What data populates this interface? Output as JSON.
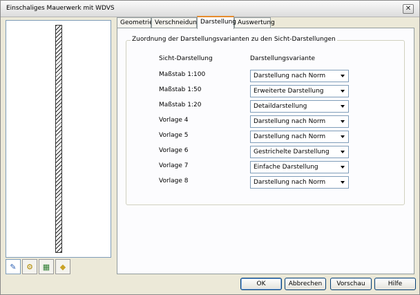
{
  "window": {
    "title": "Einschaliges Mauerwerk mit WDVS",
    "close_glyph": "✕"
  },
  "side_tabs": [
    {
      "icon": "wall-icon",
      "glyph": "✎"
    },
    {
      "icon": "materials-icon",
      "glyph": "⚙"
    },
    {
      "icon": "sheet-icon",
      "glyph": "▦"
    },
    {
      "icon": "tag-icon",
      "glyph": "◆"
    }
  ],
  "tabs": [
    {
      "label": "Geometrie"
    },
    {
      "label": "Verschneidung"
    },
    {
      "label": "Darstellung",
      "active": true
    },
    {
      "label": "Auswertung"
    }
  ],
  "group": {
    "legend": "Zuordnung der Darstellungsvarianten zu den Sicht-Darstellungen",
    "col_view": "Sicht-Darstellung",
    "col_variant": "Darstellungsvariante",
    "rows": [
      {
        "label": "Maßstab 1:100",
        "value": "Darstellung nach Norm"
      },
      {
        "label": "Maßstab 1:50",
        "value": "Erweiterte Darstellung"
      },
      {
        "label": "Maßstab 1:20",
        "value": "Detaildarstellung"
      },
      {
        "label": "Vorlage 4",
        "value": "Darstellung nach Norm"
      },
      {
        "label": "Vorlage 5",
        "value": "Darstellung nach Norm"
      },
      {
        "label": "Vorlage 6",
        "value": "Gestrichelte Darstellung"
      },
      {
        "label": "Vorlage 7",
        "value": "Einfache Darstellung"
      },
      {
        "label": "Vorlage 8",
        "value": "Darstellung nach Norm"
      }
    ]
  },
  "buttons": {
    "ok": "OK",
    "cancel": "Abbrechen",
    "preview": "Vorschau",
    "help": "Hilfe"
  },
  "colors": {
    "accent_tab": "#e68b2c",
    "field_border": "#7f9db9"
  }
}
